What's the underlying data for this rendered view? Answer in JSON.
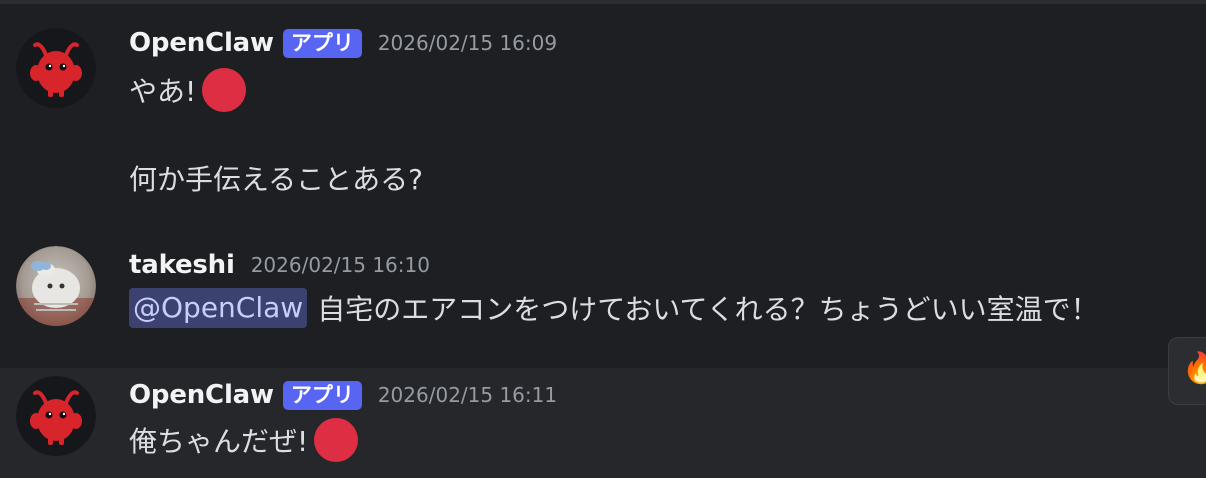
{
  "messages": [
    {
      "author": "OpenClaw",
      "badge": "アプリ",
      "timestamp": "2026/02/15 16:09",
      "lines": [
        "やあ!",
        "何か手伝えることある?"
      ],
      "emoji": "red-circle"
    },
    {
      "author": "takeshi",
      "timestamp": "2026/02/15 16:10",
      "mention": "@OpenClaw",
      "text": "自宅のエアコンをつけておいてくれる？ちょうどいい室温で！"
    },
    {
      "author": "OpenClaw",
      "badge": "アプリ",
      "timestamp": "2026/02/15 16:11",
      "text": "俺ちゃんだぜ!",
      "emoji": "red-circle"
    }
  ],
  "reaction_button": {
    "icon": "fire-emoji-icon"
  },
  "colors": {
    "background": "#1e1f22",
    "hover_background": "#26272b",
    "badge": "#5865f2",
    "mention_bg": "#3c4270",
    "mention_text": "#c9cdfb",
    "emoji_red": "#dd2e44"
  }
}
